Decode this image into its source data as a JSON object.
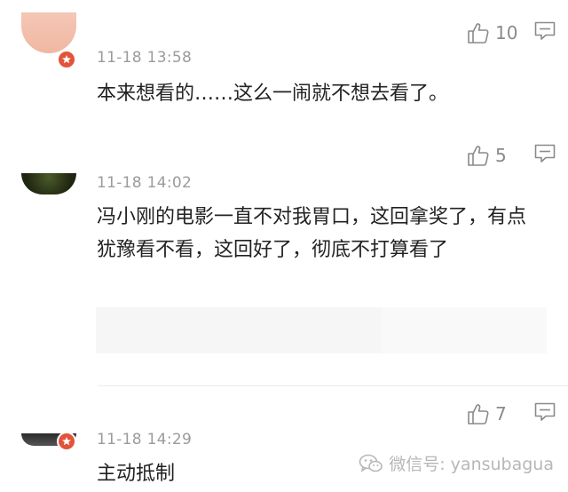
{
  "comments": [
    {
      "timestamp": "11-18 13:58",
      "text": "本来想看的……这么一闹就不想去看了。",
      "likes": "10",
      "avatar_icon": "user-avatar",
      "verified": true
    },
    {
      "timestamp": "11-18 14:02",
      "text": "冯小刚的电影一直不对我胃口，这回拿奖了，有点犹豫看不看，这回好了，彻底不打算看了",
      "likes": "5",
      "avatar_icon": "user-avatar",
      "verified": false
    },
    {
      "timestamp": "11-18 14:29",
      "text": "主动抵制",
      "likes": "7",
      "avatar_icon": "user-avatar",
      "verified": true
    }
  ],
  "watermark": {
    "text": "微信号: yansubagua",
    "icon": "wechat-icon"
  },
  "colors": {
    "badge": "#e2533b",
    "icon_gray": "#8a8a8a",
    "timestamp": "#9b9b9b",
    "text": "#222222"
  }
}
